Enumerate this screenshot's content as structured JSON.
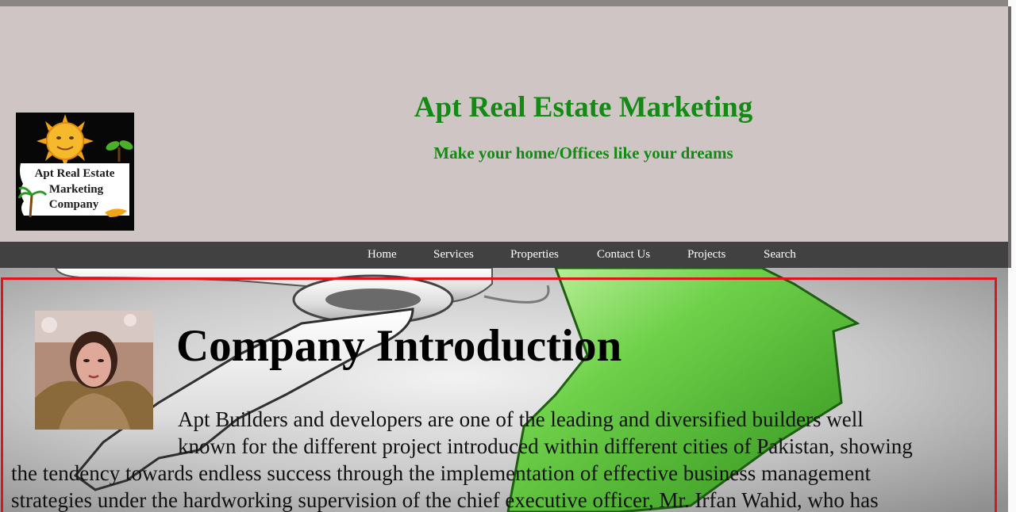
{
  "header": {
    "logo": {
      "lines": [
        "Apt Real Estate",
        "Marketing",
        "Company"
      ],
      "icon": "sun-plant-logo"
    },
    "title": "Apt Real Estate Marketing",
    "tagline": "Make your home/Offices like your dreams"
  },
  "nav": {
    "items": [
      "Home",
      "Services",
      "Properties",
      "Contact Us",
      "Projects",
      "Search"
    ]
  },
  "content": {
    "heading": "Company Introduction",
    "paragraph_lines": [
      "Apt Builders and developers are one of the leading and diversified builders well",
      "known for the different project introduced within different cities of Pakistan, showing",
      "the tendency towards endless success through the implementation of effective business management",
      "strategies under the hardworking supervision of the chief executive officer, Mr. Irfan Wahid, who has"
    ]
  },
  "colors": {
    "header_bg": "#cfc5c4",
    "title_green": "#138a13",
    "nav_bg": "#414141",
    "frame_red": "#e0141a"
  }
}
